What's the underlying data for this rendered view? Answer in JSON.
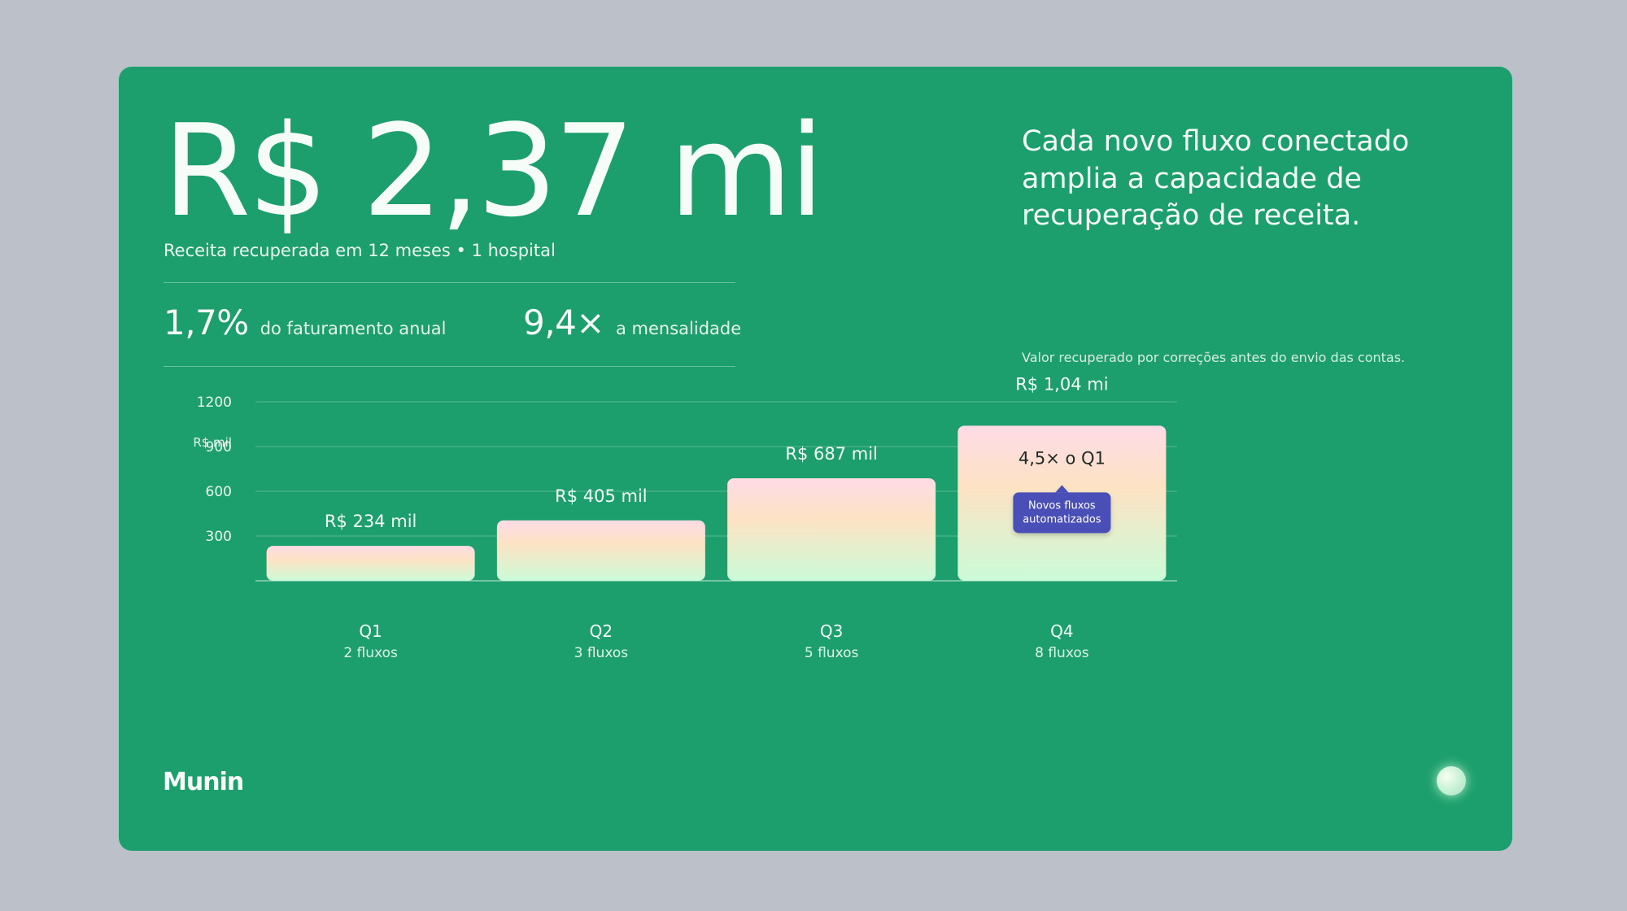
{
  "headline": "R$ 2,37 mi",
  "subhead": "Receita recuperada em 12 meses • 1 hospital",
  "metrics": [
    {
      "value": "1,7%",
      "label": "do faturamento anual"
    },
    {
      "value": "9,4×",
      "label": "a mensalidade"
    }
  ],
  "tagline": "Cada novo fluxo conectado amplia a capacidade de recuperação de receita.",
  "footnote": "Valor recuperado por correções antes do envio das contas.",
  "brand": "Munin",
  "chart_data": {
    "type": "bar",
    "ylabel": "R$ mil",
    "ylim": [
      0,
      1200
    ],
    "yticks": [
      300,
      600,
      900,
      1200
    ],
    "grid": true,
    "categories": [
      "Q1",
      "Q2",
      "Q3",
      "Q4"
    ],
    "category_sublabels": [
      "2 fluxos",
      "3 fluxos",
      "5 fluxos",
      "8 fluxos"
    ],
    "values": [
      234,
      405,
      687,
      1040
    ],
    "data_labels": [
      "R$ 234 mil",
      "R$ 405 mil",
      "R$ 687 mil",
      "R$ 1,04 mi"
    ],
    "annotations": [
      {
        "category": "Q4",
        "text": "4,5× o Q1"
      },
      {
        "category": "Q4",
        "text": "Novos fluxos automatizados",
        "lines": [
          "Novos fluxos",
          "automatizados"
        ]
      }
    ],
    "colors": {
      "bar_top": "#ffdbe6",
      "bar_mid": "#fde3c4",
      "bar_bottom": "#cbfbd8",
      "callout": "#4a4fb6"
    }
  }
}
